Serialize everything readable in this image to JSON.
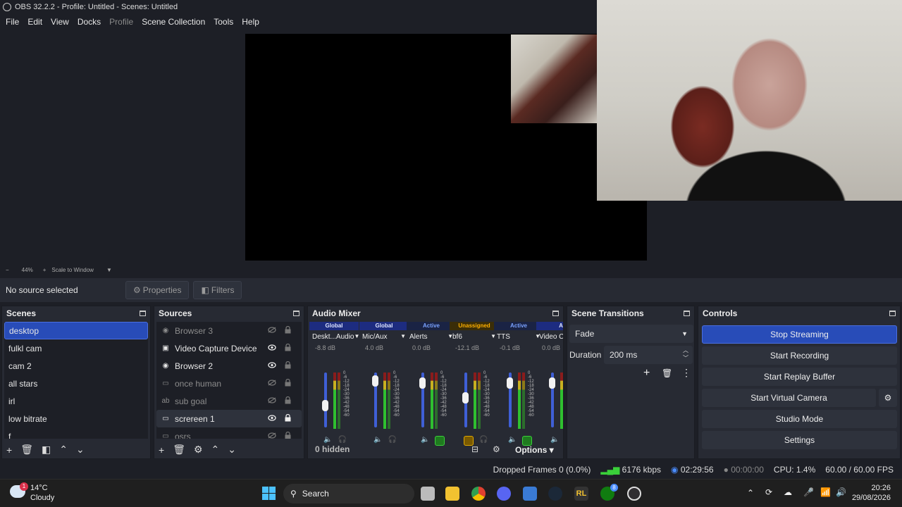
{
  "window": {
    "title": "OBS 32.2.2 - Profile: Untitled - Scenes: Untitled"
  },
  "menu": [
    "File",
    "Edit",
    "View",
    "Docks",
    "Profile",
    "Scene Collection",
    "Tools",
    "Help"
  ],
  "preview_toolbar": {
    "zoom_out": "−",
    "zoom": "44%",
    "zoom_in": "+",
    "scale_mode": "Scale to Window"
  },
  "source_toolbar": {
    "status": "No source selected",
    "properties": "Properties",
    "filters": "Filters"
  },
  "scenes": {
    "title": "Scenes",
    "items": [
      "desktop",
      "fulkl cam",
      "cam 2",
      "all stars",
      "irl",
      "low bitrate",
      "f"
    ],
    "selected": "desktop"
  },
  "sources": {
    "title": "Sources",
    "items": [
      {
        "label": "Browser 3",
        "icon": "globe-icon",
        "visible": false
      },
      {
        "label": "Video Capture Device",
        "icon": "camera-icon",
        "visible": true
      },
      {
        "label": "Browser 2",
        "icon": "globe-icon",
        "visible": true
      },
      {
        "label": "once human",
        "icon": "window-icon",
        "visible": false
      },
      {
        "label": "sub goal",
        "icon": "text-icon",
        "visible": false
      },
      {
        "label": "screreen 1",
        "icon": "monitor-icon",
        "visible": true
      },
      {
        "label": "osrs",
        "icon": "window-icon",
        "visible": false
      }
    ]
  },
  "mixer": {
    "title": "Audio Mixer",
    "channels": [
      {
        "tag": "Global",
        "name": "Deskt...Audio",
        "db": "-8.8 dB",
        "level": 0.45
      },
      {
        "tag": "Global",
        "name": "Mic/Aux",
        "db": "4.0 dB",
        "level": 0.95
      },
      {
        "tag": "Active",
        "name": "Alerts",
        "db": "0.0 dB",
        "level": 0.9
      },
      {
        "tag": "Unassigned",
        "name": "bf6",
        "db": "-12.1 dB",
        "level": 0.6
      },
      {
        "tag": "Active",
        "name": "TTS",
        "db": "-0.1 dB",
        "level": 0.9
      },
      {
        "tag": "A",
        "name": "Video C...",
        "db": "0.0 dB",
        "level": 0.9
      }
    ],
    "scale": [
      "0",
      "-6",
      "-12",
      "-18",
      "-24",
      "-30",
      "-36",
      "-42",
      "-48",
      "-54",
      "-60"
    ],
    "hidden": "0 hidden",
    "options": "Options"
  },
  "transitions": {
    "title": "Scene Transitions",
    "type": "Fade",
    "duration_label": "Duration",
    "duration": "200 ms"
  },
  "controls": {
    "title": "Controls",
    "buttons": [
      "Stop Streaming",
      "Start Recording",
      "Start Replay Buffer",
      "Start Virtual Camera",
      "Studio Mode",
      "Settings"
    ]
  },
  "status": {
    "dropped": "Dropped Frames 0 (0.0%)",
    "bitrate": "6176 kbps",
    "stream_time": "02:29:56",
    "rec_time": "00:00:00",
    "cpu": "CPU: 1.4%",
    "fps": "60.00 / 60.00 FPS"
  },
  "taskbar": {
    "weather_temp": "14°C",
    "weather_desc": "Cloudy",
    "weather_badge": "1",
    "search": "Search",
    "time": "20:26",
    "date": "29/08/2026",
    "xbox_badge": "8"
  }
}
